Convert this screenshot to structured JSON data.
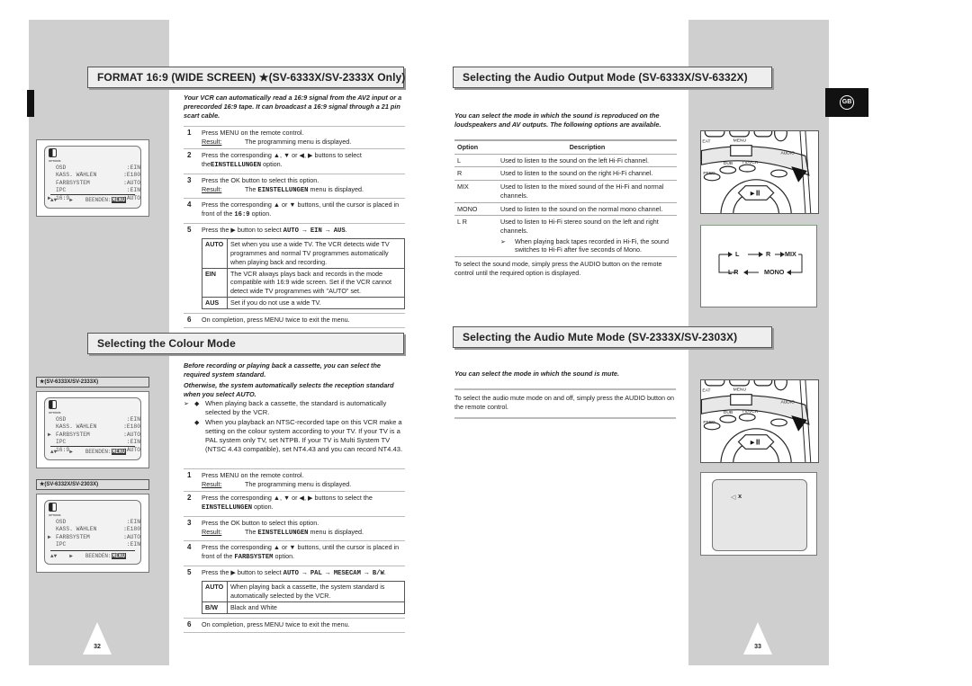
{
  "left_page": {
    "page_number": "32",
    "format_section": {
      "title": "FORMAT 16:9 (WIDE SCREEN) ★(SV-6333X/SV-2333X Only)",
      "intro": "Your VCR can automatically read a 16:9 signal from the AV2 input or a prerecorded 16:9 tape. It can broadcast a 16:9 signal through a 21 pin scart cable.",
      "steps": [
        {
          "n": "1",
          "text": "Press MENU on the remote control.",
          "result_label": "Result:",
          "result": "The programming menu is displayed."
        },
        {
          "n": "2",
          "text": "Press the corresponding ▲, ▼ or ◀, ▶ buttons to select the",
          "mono": "EINSTELLUNGEN",
          "after": " option."
        },
        {
          "n": "3",
          "text": "Press the OK button to select this option.",
          "result_label": "Result:",
          "result_pre": "The ",
          "result_mono": "EINSTELLUNGEN",
          "result_post": " menu is displayed."
        },
        {
          "n": "4",
          "text": "Press the corresponding ▲ or ▼ buttons, until the cursor is placed in front of the ",
          "mono": "16:9",
          "after": " option."
        },
        {
          "n": "5",
          "text": "Press the ▶ button to select ",
          "mono": "AUTO → EIN → AUS",
          "after": "."
        },
        {
          "n": "6",
          "text": "On completion, press MENU twice to exit the menu."
        }
      ],
      "options": [
        {
          "key": "AUTO",
          "desc": "Set when you use a wide TV. The VCR detects wide TV programmes and normal TV programmes automatically when playing back and recording."
        },
        {
          "key": "EIN",
          "desc": "The VCR always plays back and records in the mode compatible with 16:9 wide screen. Set if the VCR cannot detect wide TV programmes with \"AUTO\" set."
        },
        {
          "key": "AUS",
          "desc": "Set if you do not use a wide TV."
        }
      ],
      "osd": {
        "icon_label": "OPTIONS",
        "rows": [
          [
            "OSD",
            ":EIN"
          ],
          [
            "KASS. WÄHLEN",
            ":E180"
          ],
          [
            "FARBSYSTEM",
            ":AUTO"
          ],
          [
            "IPC",
            ":EIN"
          ],
          [
            "16:9",
            ":AUTO"
          ]
        ],
        "cursor_row": 4,
        "footer": [
          "▲▼",
          "▶",
          "BEENDEN:",
          "MENU"
        ]
      }
    },
    "colour_section": {
      "title": "Selecting the Colour Mode",
      "intro1": "Before recording or playing back a cassette, you can select the required system standard.",
      "intro2": "Otherwise, the system automatically selects the reception standard when you select AUTO.",
      "notes": [
        "When playing back a cassette, the standard is automatically selected by the VCR.",
        "When you playback an NTSC-recorded tape on this VCR make a setting on the colour system according to your TV. If your TV is a  PAL system only TV, set NTPB. If your TV is Multi System TV (NTSC 4.43 compatible), set NT4.43 and you can record NT4.43."
      ],
      "steps": [
        {
          "n": "1",
          "text": "Press MENU on the remote control.",
          "result_label": "Result:",
          "result": "The programming menu is displayed."
        },
        {
          "n": "2",
          "text": "Press the corresponding ▲, ▼ or ◀, ▶ buttons to select the ",
          "mono": "EINSTELLUNGEN",
          "after": " option."
        },
        {
          "n": "3",
          "text": "Press the OK button to select this option.",
          "result_label": "Result:",
          "result_pre": "The ",
          "result_mono": "EINSTELLUNGEN",
          "result_post": " menu is displayed."
        },
        {
          "n": "4",
          "text": "Press the corresponding ▲ or ▼ buttons, until the cursor is placed in front of the ",
          "mono": "FARBSYSTEM",
          "after": " option."
        },
        {
          "n": "5",
          "text": "Press the ▶ button to select ",
          "mono": "AUTO → PAL → MESECAM → B/W",
          "after": "."
        },
        {
          "n": "6",
          "text": "On completion, press MENU twice to exit the menu."
        }
      ],
      "options": [
        {
          "key": "AUTO",
          "desc": "When playing back a cassette, the system standard is automatically selected by the VCR."
        },
        {
          "key": "B/W",
          "desc": "Black and White"
        }
      ],
      "osd_a": {
        "label": "★(SV-6333X/SV-2333X)",
        "icon_label": "OPTIONS",
        "rows": [
          [
            "OSD",
            ":EIN"
          ],
          [
            "KASS. WÄHLEN",
            ":E180"
          ],
          [
            "FARBSYSTEM",
            ":AUTO"
          ],
          [
            "IPC",
            ":EIN"
          ],
          [
            "16:9",
            ":AUTO"
          ]
        ],
        "cursor_row": 2
      },
      "osd_b": {
        "label": "★(SV-6332X/SV-2303X)",
        "icon_label": "OPTIONS",
        "rows": [
          [
            "OSD",
            ":EIN"
          ],
          [
            "KASS. WÄHLEN",
            ":E180"
          ],
          [
            "FARBSYSTEM",
            ":AUTO"
          ],
          [
            "IPC",
            ":EIN"
          ]
        ],
        "cursor_row": 2
      }
    }
  },
  "right_page": {
    "page_number": "33",
    "language_tab": "GB",
    "audio_output": {
      "title": "Selecting the Audio Output Mode (SV-6333X/SV-6332X)",
      "intro": "You can select the mode in which the sound is reproduced on the loudspeakers and AV outputs. The following options are available.",
      "table_headers": [
        "Option",
        "Description"
      ],
      "rows": [
        [
          "L",
          "Used to listen to the sound on the left Hi-Fi channel."
        ],
        [
          "R",
          "Used to listen to the sound on the right Hi-Fi channel."
        ],
        [
          "MIX",
          "Used to listen to the mixed sound of the Hi-Fi and normal channels."
        ],
        [
          "MONO",
          "Used to listen to the sound on the normal mono channel."
        ],
        [
          "L R",
          "Used to listen to Hi-Fi stereo sound on the left and right channels."
        ]
      ],
      "note": "When playing back tapes recorded in Hi-Fi, the sound switches to Hi-Fi after five seconds of Mono.",
      "instruction": "To select the sound mode, simply press the AUDIO button on the remote control until the required option is displayed.",
      "remote_labels": [
        "EAT",
        "MENU",
        "AUDIO",
        "DUB",
        "TV/VCR",
        "PEED",
        "►II"
      ],
      "cycle": [
        "L",
        "R",
        "MIX",
        "MONO",
        "L R"
      ]
    },
    "audio_mute": {
      "title": "Selecting the Audio Mute Mode (SV-2333X/SV-2303X)",
      "intro": "You can select the mode in which the sound is mute.",
      "instruction": "To select the audio mute mode on and off, simply press the AUDIO button on the remote control.",
      "screen_text": "x",
      "icon": "speaker-mute-icon"
    }
  }
}
